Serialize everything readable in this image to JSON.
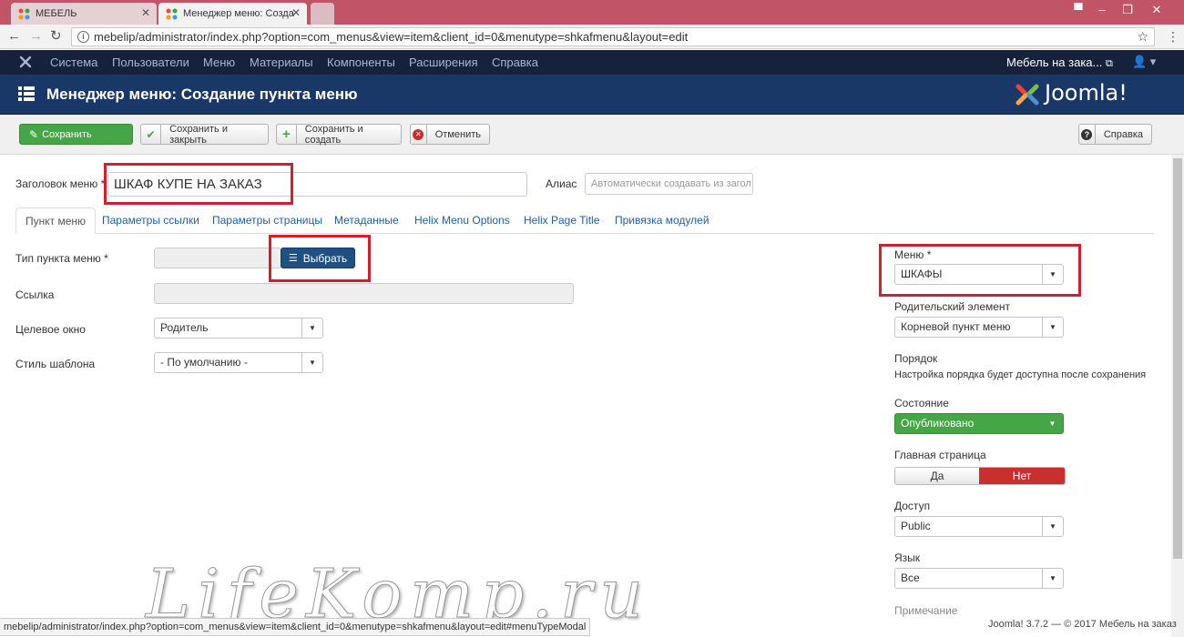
{
  "browser": {
    "tabs": [
      {
        "title": "МЕБЕЛЬ"
      },
      {
        "title": "Менеджер меню: Созда"
      }
    ],
    "url": "mebelip/administrator/index.php?option=com_menus&view=item&client_id=0&menutype=shkafmenu&layout=edit",
    "status_url": "mebelip/administrator/index.php?option=com_menus&view=item&client_id=0&menutype=shkafmenu&layout=edit#menuTypeModal"
  },
  "topnav": {
    "items": [
      "Система",
      "Пользователи",
      "Меню",
      "Материалы",
      "Компоненты",
      "Расширения",
      "Справка"
    ],
    "site_name": "Мебель на зака..."
  },
  "header": {
    "title": "Менеджер меню: Создание пункта меню",
    "logo_text": "Joomla!"
  },
  "toolbar": {
    "save": "Сохранить",
    "save_close": "Сохранить и закрыть",
    "save_new": "Сохранить и создать",
    "cancel": "Отменить",
    "help": "Справка"
  },
  "form": {
    "title_label": "Заголовок меню *",
    "title_value": "ШКАФ КУПЕ НА ЗАКАЗ",
    "alias_label": "Алиас",
    "alias_placeholder": "Автоматически создавать из загол",
    "tabs": [
      "Пункт меню",
      "Параметры ссылки",
      "Параметры страницы",
      "Метаданные",
      "Helix Menu Options",
      "Helix Page Title",
      "Привязка модулей"
    ],
    "type_label": "Тип пункта меню *",
    "select_button": "Выбрать",
    "link_label": "Ссылка",
    "target_label": "Целевое окно",
    "target_value": "Родитель",
    "style_label": "Стиль шаблона",
    "style_value": "- По умолчанию -"
  },
  "sidebar": {
    "menu_label": "Меню *",
    "menu_value": "ШКАФЫ",
    "parent_label": "Родительский элемент",
    "parent_value": "Корневой пункт меню",
    "order_label": "Порядок",
    "order_text": "Настройка порядка будет доступна после сохранения",
    "state_label": "Состояние",
    "state_value": "Опубликовано",
    "home_label": "Главная страница",
    "home_yes": "Да",
    "home_no": "Нет",
    "access_label": "Доступ",
    "access_value": "Public",
    "language_label": "Язык",
    "language_value": "Все",
    "note_label": "Примечание"
  },
  "footer": {
    "text": "Joomla! 3.7.2 — © 2017 Мебель на заказ"
  },
  "watermark": "LifeKomp.ru",
  "colors": {
    "tabbar": "#c25467",
    "header": "#1a3867",
    "topnav": "#16213b",
    "save_green": "#46a546",
    "published_green": "#46a546",
    "no_red": "#c9302c",
    "select_blue": "#205081",
    "highlight_red": "#d0202f"
  }
}
